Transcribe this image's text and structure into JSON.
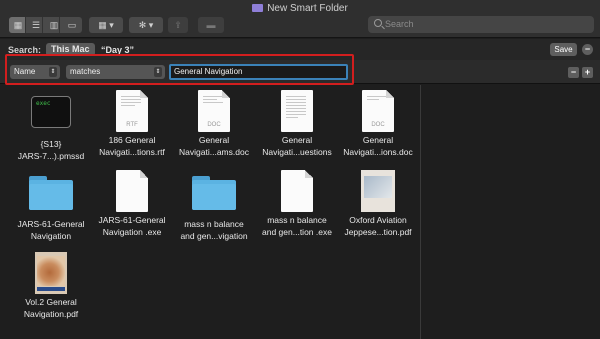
{
  "window": {
    "title": "New Smart Folder"
  },
  "toolbar": {
    "search_placeholder": "Search",
    "icons": [
      "icon-view-icon",
      "list-view-icon",
      "column-view-icon",
      "gallery-view-icon",
      "group-icon",
      "action-gear-icon",
      "share-icon",
      "tag-icon"
    ]
  },
  "scope": {
    "label": "Search:",
    "this_mac": "This Mac",
    "folder": "“Day 3”",
    "save_label": "Save",
    "minus": "−",
    "plus": "+"
  },
  "criteria": {
    "attribute": "Name",
    "operator": "matches",
    "value": "General Navigation",
    "minus": "−",
    "plus": "+"
  },
  "items": [
    {
      "line1": "{S13}",
      "line2": "JARS-7...).pmssd",
      "kind": "exec",
      "icon_text": "exec"
    },
    {
      "line1": "186   General",
      "line2": "Navigati...tions.rtf",
      "kind": "doc",
      "tag": "RTF"
    },
    {
      "line1": "General",
      "line2": "Navigati...ams.doc",
      "kind": "doc",
      "tag": "DOC"
    },
    {
      "line1": "General",
      "line2": "Navigati...uestions",
      "kind": "doc-lines",
      "tag": ""
    },
    {
      "line1": "General",
      "line2": "Navigati...ions.doc",
      "kind": "doc",
      "tag": "DOC"
    },
    {
      "line1": "JARS-61-General",
      "line2": "Navigation",
      "kind": "folder"
    },
    {
      "line1": "JARS-61-General",
      "line2": "Navigation .exe",
      "kind": "blank"
    },
    {
      "line1": "mass n balance",
      "line2": "and gen...vigation",
      "kind": "folder"
    },
    {
      "line1": "mass n balance",
      "line2": "and gen...tion .exe",
      "kind": "blank"
    },
    {
      "line1": "Oxford Aviation",
      "line2": "Jeppese...tion.pdf",
      "kind": "photo"
    },
    {
      "line1": "Vol.2 General",
      "line2": "Navigation.pdf",
      "kind": "cover"
    }
  ]
}
